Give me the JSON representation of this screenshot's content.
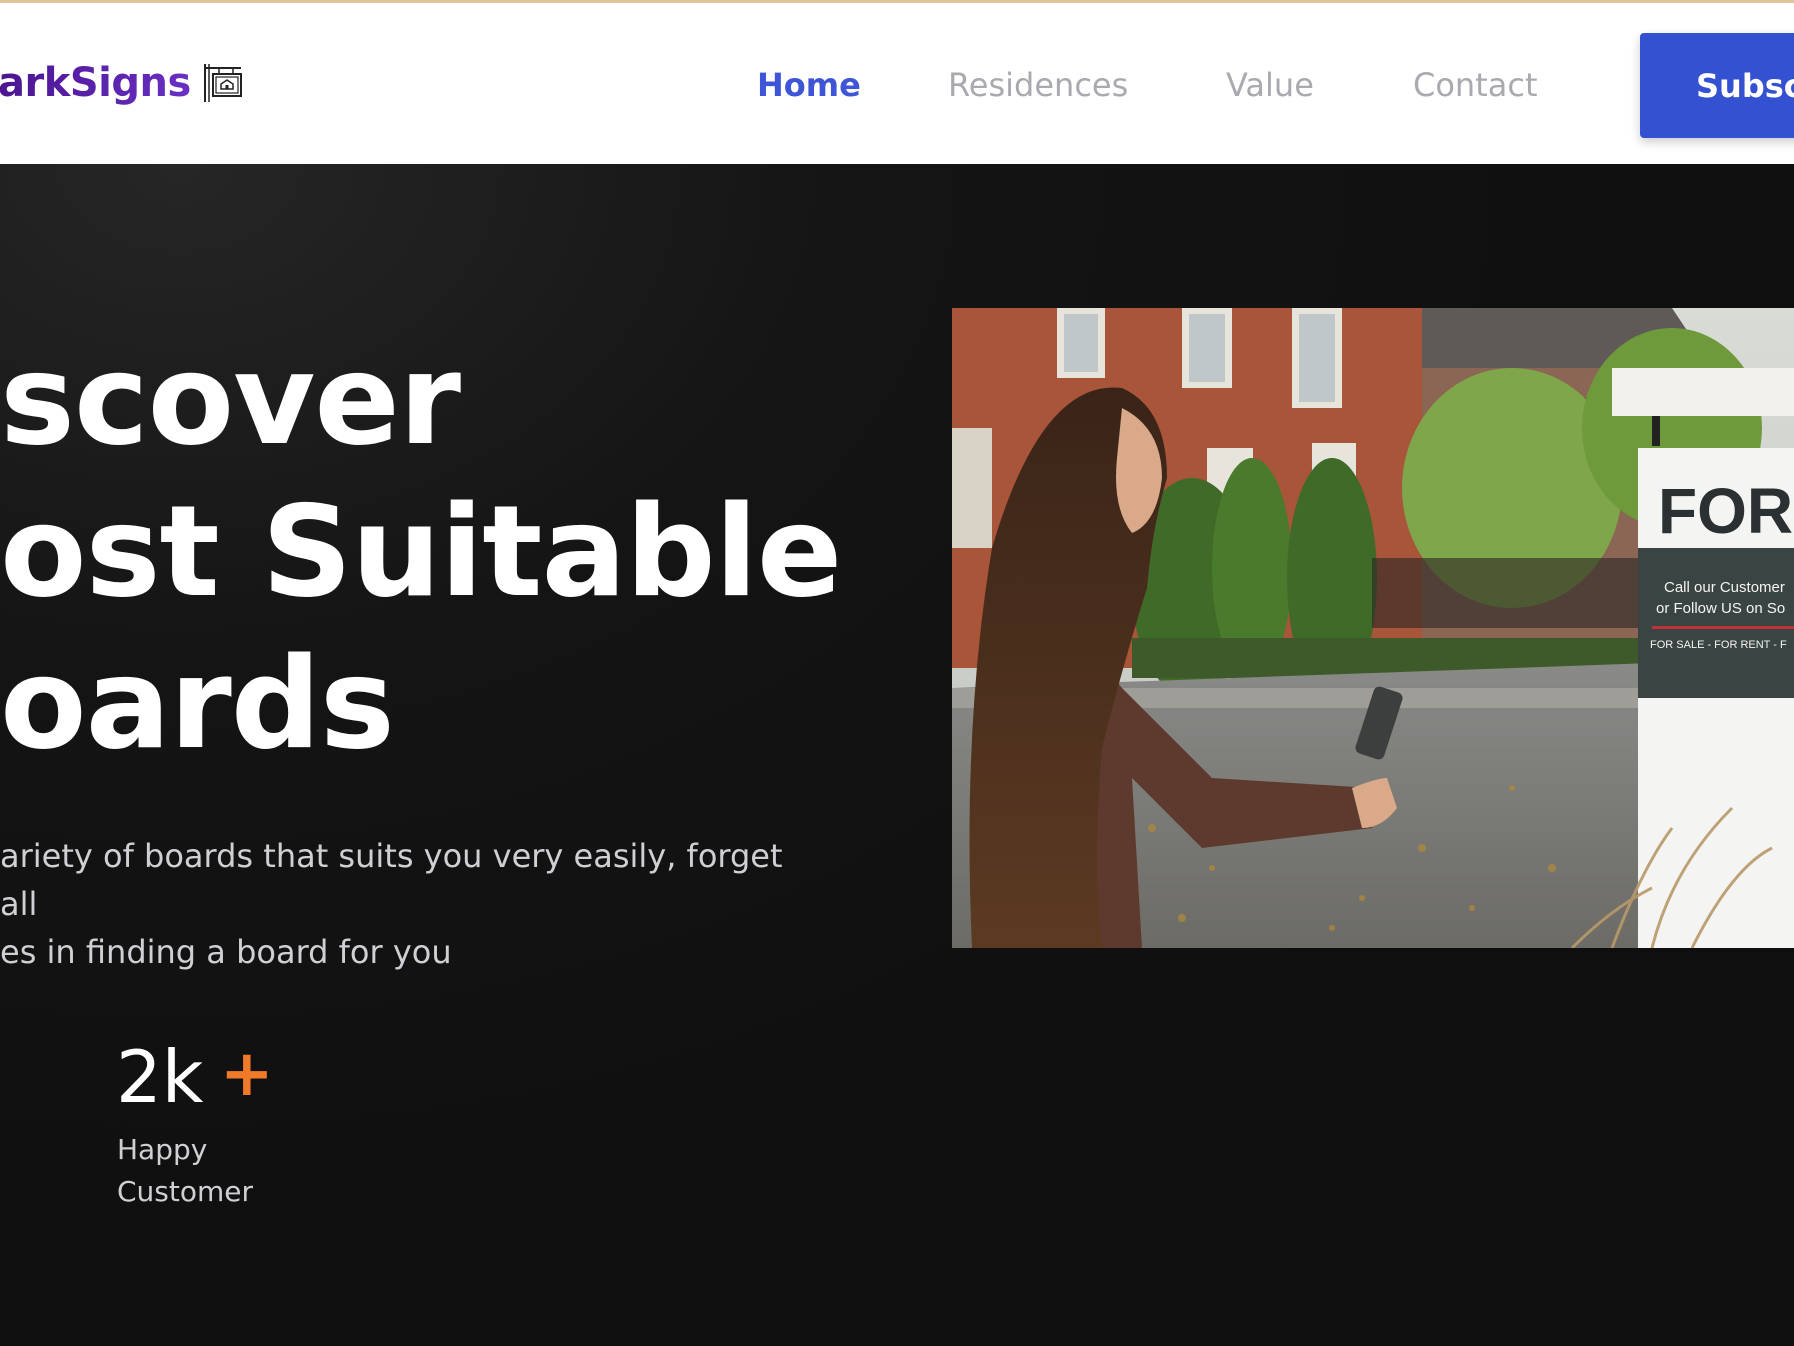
{
  "header": {
    "logo_text": "arkSigns",
    "nav": [
      {
        "label": "Home",
        "active": true
      },
      {
        "label": "Residences",
        "active": false
      },
      {
        "label": "Value",
        "active": false
      },
      {
        "label": "Contact",
        "active": false
      }
    ],
    "subscribe_label": "Subsc"
  },
  "hero": {
    "title_lines": [
      "scover",
      "ost Suitable",
      "oards"
    ],
    "description": "ariety of boards that suits you very easily, forget all es in finding a board for you",
    "description_lines": [
      "ariety of boards that suits you very easily, forget all",
      "es in finding a board for you"
    ],
    "stat": {
      "value": "2k",
      "suffix": "+",
      "label_lines": [
        "Happy",
        "Customer"
      ]
    },
    "photo": {
      "sign_heading": "FOR S",
      "sign_line1": "Call our Customer",
      "sign_line2": "or Follow US on So",
      "sign_footer": "FOR SALE - FOR RENT - F"
    }
  },
  "colors": {
    "accent_blue": "#3451d1",
    "nav_active": "#3d55d6",
    "plus_orange": "#f07a2a",
    "logo_purple": "#4b1590",
    "hero_bg": "#101010"
  }
}
